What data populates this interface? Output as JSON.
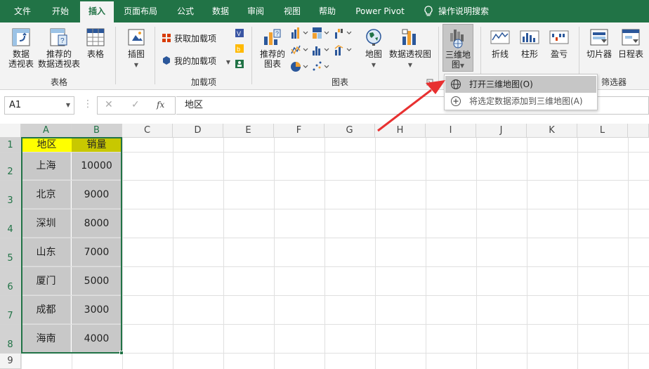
{
  "tabs": [
    {
      "label": "文件"
    },
    {
      "label": "开始"
    },
    {
      "label": "插入"
    },
    {
      "label": "页面布局"
    },
    {
      "label": "公式"
    },
    {
      "label": "数据"
    },
    {
      "label": "审阅"
    },
    {
      "label": "视图"
    },
    {
      "label": "帮助"
    },
    {
      "label": "Power Pivot"
    },
    {
      "label": "操作说明搜索"
    }
  ],
  "ribbon": {
    "pivot_table_line1": "数据",
    "pivot_table_line2": "透视表",
    "recommended_pivot_line1": "推荐的",
    "recommended_pivot_line2": "数据透视表",
    "table": "表格",
    "tables_group": "表格",
    "illustrations": "插图",
    "get_addins": "获取加载项",
    "my_addins": "我的加载项",
    "addins_group": "加载项",
    "recommended_charts_line1": "推荐的",
    "recommended_charts_line2": "图表",
    "maps": "地图",
    "pivot_chart": "数据透视图",
    "charts_group": "图表",
    "map3d_line1": "三维地",
    "map3d_line2": "图",
    "line_spark": "折线",
    "column_spark": "柱形",
    "winloss_spark": "盈亏",
    "slicer": "切片器",
    "timeline": "日程表",
    "filters_group": "筛选器"
  },
  "formula_bar": {
    "name_box": "A1",
    "cancel": "✕",
    "enter": "✓",
    "fx": "fx",
    "content": "地区"
  },
  "columns": [
    "A",
    "B",
    "C",
    "D",
    "E",
    "F",
    "G",
    "H",
    "I",
    "J",
    "K",
    "L"
  ],
  "rows": [
    "1",
    "2",
    "3",
    "4",
    "5",
    "6",
    "7",
    "8",
    "9"
  ],
  "sheet": {
    "header_region": "地区",
    "header_sales": "销量",
    "data": [
      {
        "region": "上海",
        "sales": "10000"
      },
      {
        "region": "北京",
        "sales": "9000"
      },
      {
        "region": "深圳",
        "sales": "8000"
      },
      {
        "region": "山东",
        "sales": "7000"
      },
      {
        "region": "厦门",
        "sales": "5000"
      },
      {
        "region": "成都",
        "sales": "3000"
      },
      {
        "region": "海南",
        "sales": "4000"
      }
    ]
  },
  "menu": {
    "open_3d_map": "打开三维地图(O)",
    "add_to_3d_map": "将选定数据添加到三维地图(A)"
  },
  "colors": {
    "accent": "#217346",
    "header_a": "#ffff00",
    "header_b": "#c8c800",
    "data_fill": "#c8c8c8",
    "arrow": "#e83030"
  }
}
